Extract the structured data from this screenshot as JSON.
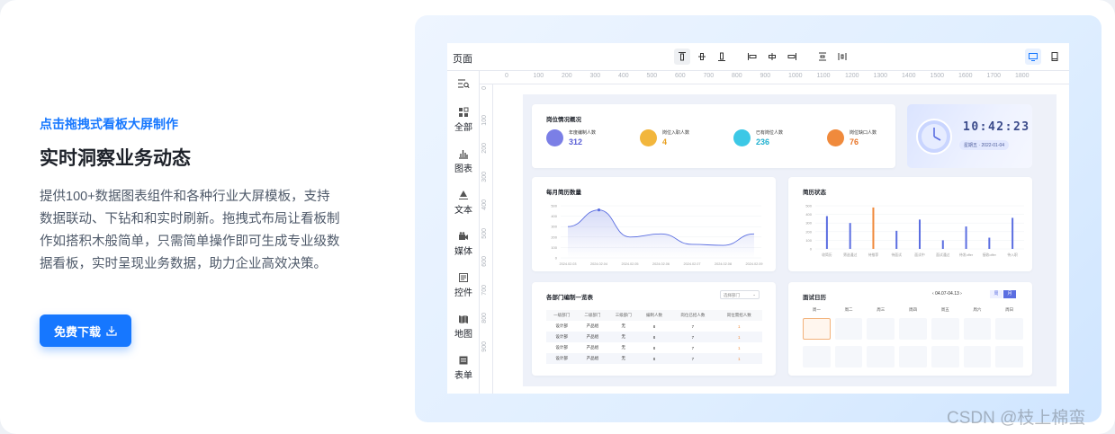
{
  "left": {
    "subtitle": "点击拖拽式看板大屏制作",
    "title": "实时洞察业务动态",
    "description": "提供100+数据图表组件和各种行业大屏模板，支持数据联动、下钻和和实时刷新。拖拽式布局让看板制作如搭积木般简单，只需简单操作即可生成专业级数据看板，实时呈现业务数据，助力企业高效决策。",
    "download_label": "免费下载"
  },
  "editor": {
    "page_label": "页面",
    "sidebar": [
      "全部",
      "图表",
      "文本",
      "媒体",
      "控件",
      "地图",
      "表单"
    ],
    "ruler_top": [
      "0",
      "100",
      "200",
      "300",
      "400",
      "500",
      "600",
      "700",
      "800",
      "900",
      "1000",
      "1100",
      "1200",
      "1300",
      "1400",
      "1500",
      "1600",
      "1700",
      "1800"
    ],
    "ruler_left": [
      "0",
      "100",
      "200",
      "300",
      "400",
      "500",
      "600",
      "700",
      "800",
      "900"
    ]
  },
  "dashboard": {
    "overview_title": "岗位情况概况",
    "stats": [
      {
        "label": "年度编制人数",
        "value": "312",
        "color": "#7b7fe6"
      },
      {
        "label": "岗位入职人数",
        "value": "4",
        "color": "#f2b63c"
      },
      {
        "label": "已有岗位人数",
        "value": "236",
        "color": "#3cc8e6"
      },
      {
        "label": "岗位缺口人数",
        "value": "76",
        "color": "#f08a3c"
      }
    ],
    "clock_time": "10:42:23",
    "clock_day": "星期五",
    "clock_date": "2022-01-04",
    "monthly_title": "每月简历数量",
    "status_title": "简历状态",
    "table_title": "各部门编制一览表",
    "table_select": "选择部门",
    "table_headers": [
      "一级部门",
      "二级部门",
      "三级部门",
      "编制人数",
      "岗位已招人数",
      "岗位需招人数"
    ],
    "table_rows": [
      [
        "设计部",
        "产品组",
        "无",
        "8",
        "7",
        "1"
      ],
      [
        "设计部",
        "产品组",
        "无",
        "8",
        "7",
        "1"
      ],
      [
        "设计部",
        "产品组",
        "无",
        "8",
        "7",
        "1"
      ],
      [
        "设计部",
        "产品组",
        "无",
        "8",
        "7",
        "1"
      ]
    ],
    "calendar_title": "面试日历",
    "calendar_range": "04.07-04.13",
    "calendar_week_btn": "周",
    "calendar_month_btn": "月",
    "calendar_days": [
      "周一",
      "周二",
      "周三",
      "周四",
      "周五",
      "周六",
      "周日"
    ]
  },
  "chart_data": [
    {
      "type": "area",
      "title": "每月简历数量",
      "x": [
        "2024.02.03",
        "2024.02.04",
        "2024.02.05",
        "2024.02.06",
        "2024.02.07",
        "2024.02.08",
        "2024.02.09"
      ],
      "values": [
        300,
        460,
        200,
        230,
        130,
        120,
        230
      ],
      "ylim": [
        0,
        500
      ],
      "yticks": [
        "500",
        "400",
        "300",
        "200",
        "100",
        "0"
      ],
      "color": "#5b6ee1"
    },
    {
      "type": "bar",
      "title": "简历状态",
      "categories": [
        "收简历",
        "筛选通过",
        "待推荐",
        "待面试",
        "面试中",
        "面试通过",
        "待发offer",
        "接收offer",
        "待入职"
      ],
      "values": [
        380,
        300,
        480,
        210,
        340,
        100,
        260,
        130,
        360
      ],
      "ylim": [
        0,
        500
      ],
      "yticks": [
        "500",
        "400",
        "300",
        "200",
        "100",
        "0"
      ],
      "colors": [
        "#5b6ee1",
        "#5b6ee1",
        "#f08a3c",
        "#5b6ee1",
        "#5b6ee1",
        "#5b6ee1",
        "#5b6ee1",
        "#5b6ee1",
        "#5b6ee1"
      ]
    }
  ],
  "watermark": "CSDN @枝上棉蛮"
}
